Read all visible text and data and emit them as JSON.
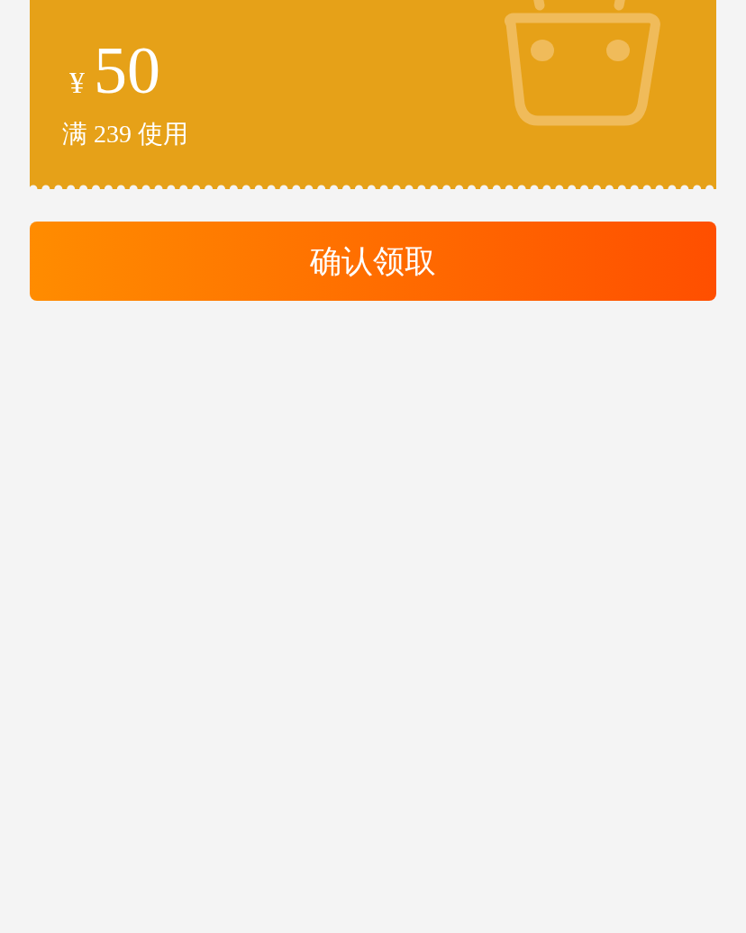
{
  "coupon": {
    "currency": "¥",
    "amount": "50",
    "condition": "满 239 使用"
  },
  "button": {
    "label": "确认领取"
  }
}
